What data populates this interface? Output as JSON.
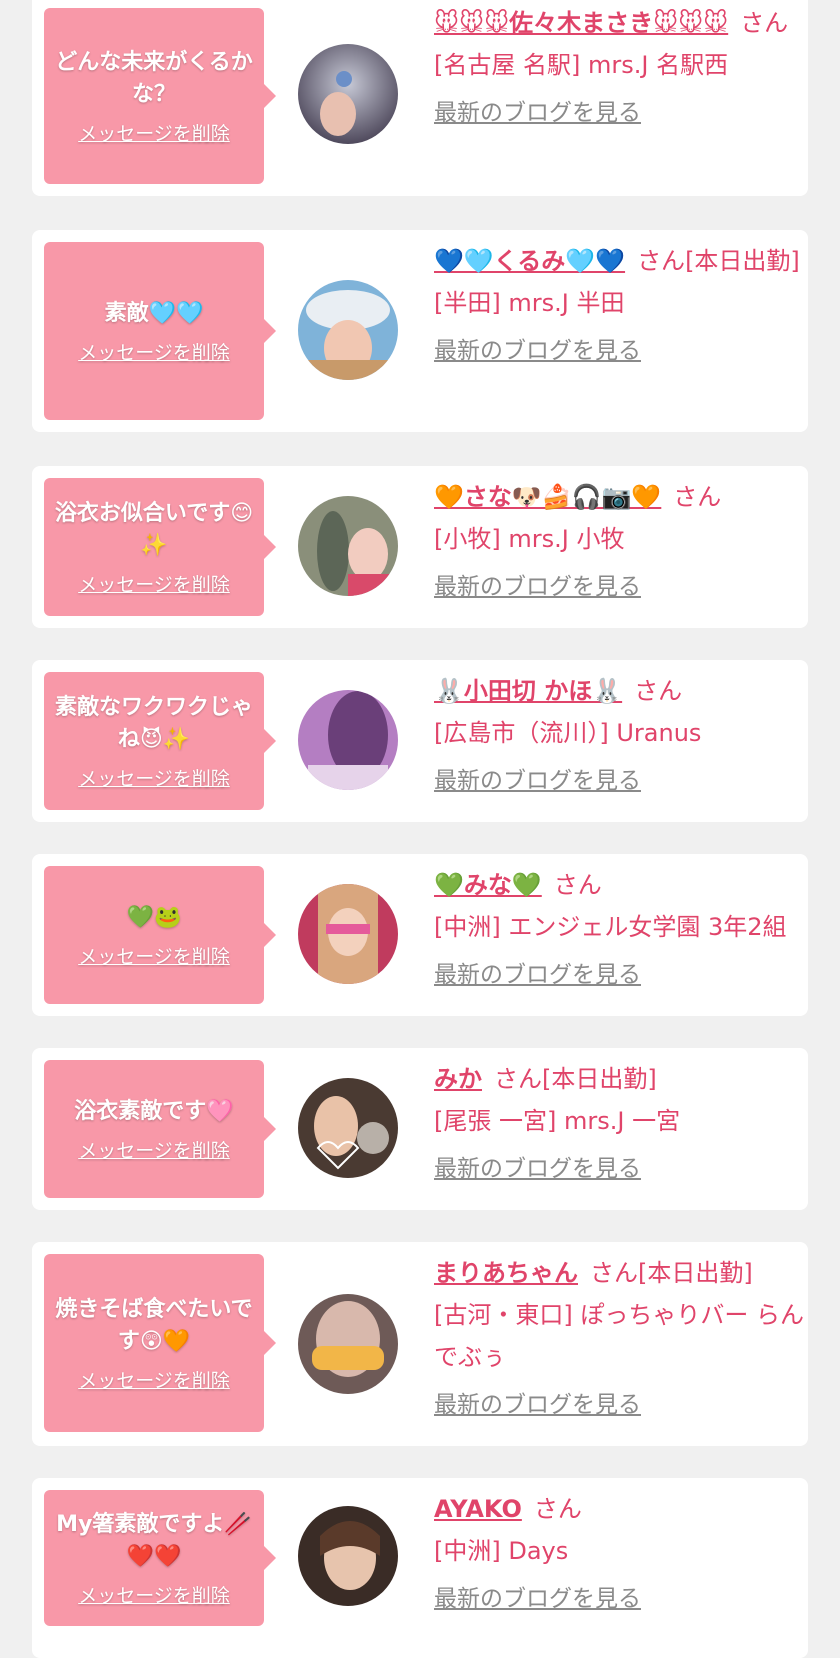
{
  "delete_label": "メッセージを削除",
  "blog_label": "最新のブログを見る",
  "honorific": "さん",
  "colors": {
    "background": "#f0f0f0",
    "card": "#ffffff",
    "bubble": "#f898a8",
    "accent": "#e0446a",
    "link_gray": "#8a8a8a"
  },
  "items": [
    {
      "message": "どんな未来がくるかな？",
      "name": "🐭🐭🐭佐々木まさき🐭🐭🐭",
      "suffix": "",
      "shop": "[名古屋 名駅] mrs.J 名駅西"
    },
    {
      "message": "素敵🩵🩵",
      "name": "💙🩵くるみ🩵💙",
      "suffix": "[本日出勤]",
      "shop": "[半田] mrs.J 半田"
    },
    {
      "message": "浴衣お似合いです😊✨",
      "name": "🧡さな🐶🍰🎧📷🧡",
      "suffix": "",
      "shop": "[小牧] mrs.J 小牧"
    },
    {
      "message": "素敵なワクワクじゃね😈✨",
      "name": "🐰小田切 かほ🐰",
      "suffix": "",
      "shop": "[広島市（流川）] Uranus"
    },
    {
      "message": "💚🐸",
      "name": "💚みな💚",
      "suffix": "",
      "shop": "[中洲] エンジェル女学園 3年2組"
    },
    {
      "message": "浴衣素敵です🩷",
      "name": "みか",
      "suffix": "[本日出勤]",
      "shop": "[尾張 一宮] mrs.J 一宮"
    },
    {
      "message": "焼きそば食べたいです😲🧡",
      "name": "まりあちゃん",
      "suffix": "[本日出勤]",
      "shop": "[古河・東口] ぽっちゃりバー らんでぶぅ"
    },
    {
      "message": "My箸素敵ですよ🥢❤️❤️",
      "name": "AYAKO",
      "suffix": "",
      "shop": "[中洲] Days"
    }
  ]
}
